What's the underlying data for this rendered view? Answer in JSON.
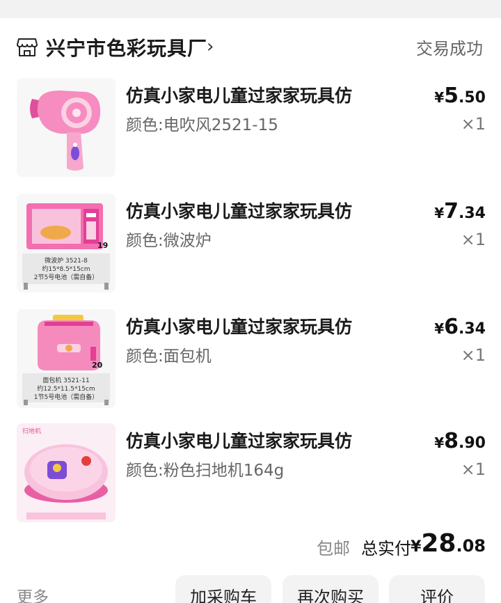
{
  "shop": {
    "name": "兴宁市色彩玩具厂",
    "chevron": "›",
    "status": "交易成功",
    "icon": "store-icon"
  },
  "items": [
    {
      "title": "仿真小家电儿童过家家玩具仿",
      "spec": "颜色:电吹风2521-15",
      "price_currency": "¥",
      "price_int": "5",
      "price_dec": ".50",
      "qty": "×1",
      "thumb_label": ""
    },
    {
      "title": "仿真小家电儿童过家家玩具仿",
      "spec": "颜色:微波炉",
      "price_currency": "¥",
      "price_int": "7",
      "price_dec": ".34",
      "qty": "×1",
      "thumb_label": "19",
      "thumb_caption": [
        "微波炉 3521-8",
        "约15*8.5*15cm",
        "2节5号电池（需自备）"
      ]
    },
    {
      "title": "仿真小家电儿童过家家玩具仿",
      "spec": "颜色:面包机",
      "price_currency": "¥",
      "price_int": "6",
      "price_dec": ".34",
      "qty": "×1",
      "thumb_label": "20",
      "thumb_caption": [
        "面包机 3521-11",
        "约12.5*11.5*15cm",
        "1节5号电池（需自备）"
      ]
    },
    {
      "title": "仿真小家电儿童过家家玩具仿",
      "spec": "颜色:粉色扫地机164g",
      "price_currency": "¥",
      "price_int": "8",
      "price_dec": ".90",
      "qty": "×1",
      "thumb_label": "扫地机"
    }
  ],
  "summary": {
    "free_shipping": "包邮",
    "total_label": "总实付",
    "total_currency": "¥",
    "total_int": "28",
    "total_dec": ".08"
  },
  "actions": {
    "more": "更多",
    "add_cart": "加采购车",
    "buy_again": "再次购买",
    "review": "评价"
  },
  "colors": {
    "toy_pink": "#f07bb4",
    "toy_light_pink": "#f8c3dd",
    "background_gap": "#f2f2f2",
    "button_bg": "#f3f3f3"
  }
}
